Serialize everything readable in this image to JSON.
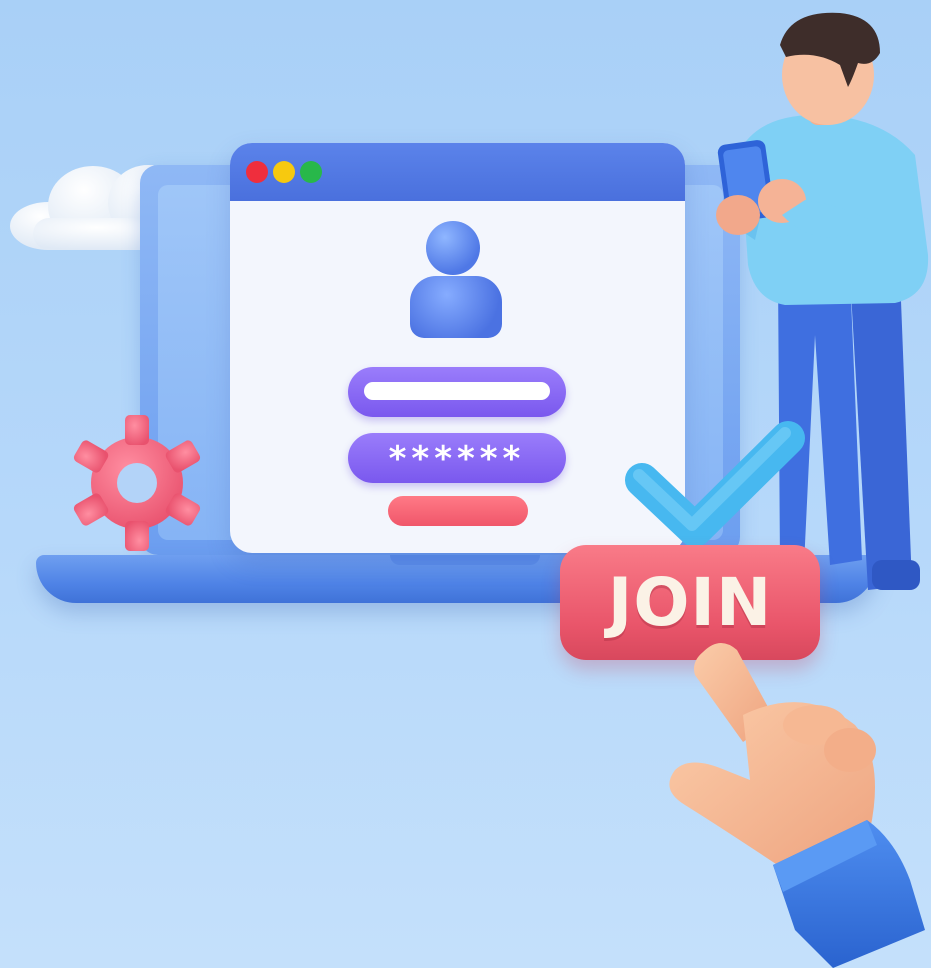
{
  "login_form": {
    "password_mask": "******"
  },
  "cta": {
    "join_label": "JOIN"
  },
  "icons": [
    "cloud-icon",
    "user-avatar-icon",
    "gear-icon",
    "checkmark-icon",
    "pointing-hand-icon",
    "person-illustration"
  ],
  "colors": {
    "background": "#b6d8fa",
    "window_bar": "#4a70dd",
    "input_field": "#7a58ee",
    "join_button": "#e9556a",
    "checkmark": "#44b8f0",
    "gear": "#f46a85"
  }
}
